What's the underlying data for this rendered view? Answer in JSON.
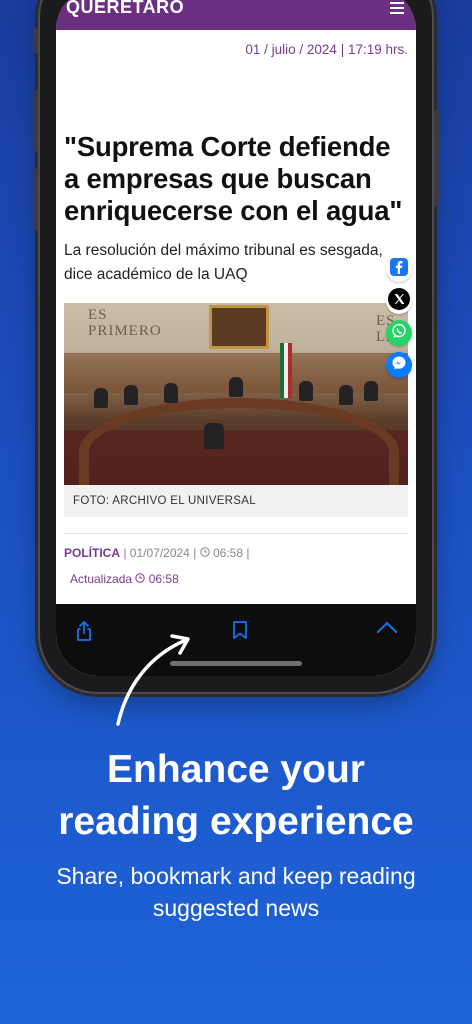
{
  "app": {
    "brand": "QUERETARO",
    "menu_icon": "hamburger-icon"
  },
  "article": {
    "date": "01 / julio / 2024 | 17:19 hrs.",
    "headline": "\"Suprema Corte defiende a empresas que buscan enriquecerse con el agua\"",
    "subtitle": "La resolución del máximo tribunal es sesgada, dice académico de la UAQ",
    "photo_wall_left": "ES PRIMERO",
    "photo_wall_right": "ES LA",
    "caption": "FOTO: ARCHIVO EL UNIVERSAL",
    "category": "POLÍTICA",
    "published_date": "01/07/2024",
    "published_time": "06:58",
    "updated_label": "Actualizada",
    "updated_time": "06:58"
  },
  "share": {
    "items": [
      {
        "name": "facebook",
        "icon": "facebook-icon",
        "color": "#1877f2"
      },
      {
        "name": "x",
        "icon": "x-icon",
        "color": "#000000"
      },
      {
        "name": "whatsapp",
        "icon": "whatsapp-icon",
        "color": "#25d366"
      },
      {
        "name": "messenger",
        "icon": "messenger-icon",
        "color": "#0a7cff"
      }
    ]
  },
  "toolbar": {
    "share_icon": "share-icon",
    "bookmark_icon": "bookmark-icon",
    "scroll_up_icon": "chevron-up-icon",
    "accent": "#1a73e8"
  },
  "promo": {
    "title_line1": "Enhance your",
    "title_line2": "reading experience",
    "subtitle_line1": "Share, bookmark and keep reading",
    "subtitle_line2": "suggested news"
  },
  "colors": {
    "brand": "#6b2f82",
    "background": "#1c4fc0"
  }
}
